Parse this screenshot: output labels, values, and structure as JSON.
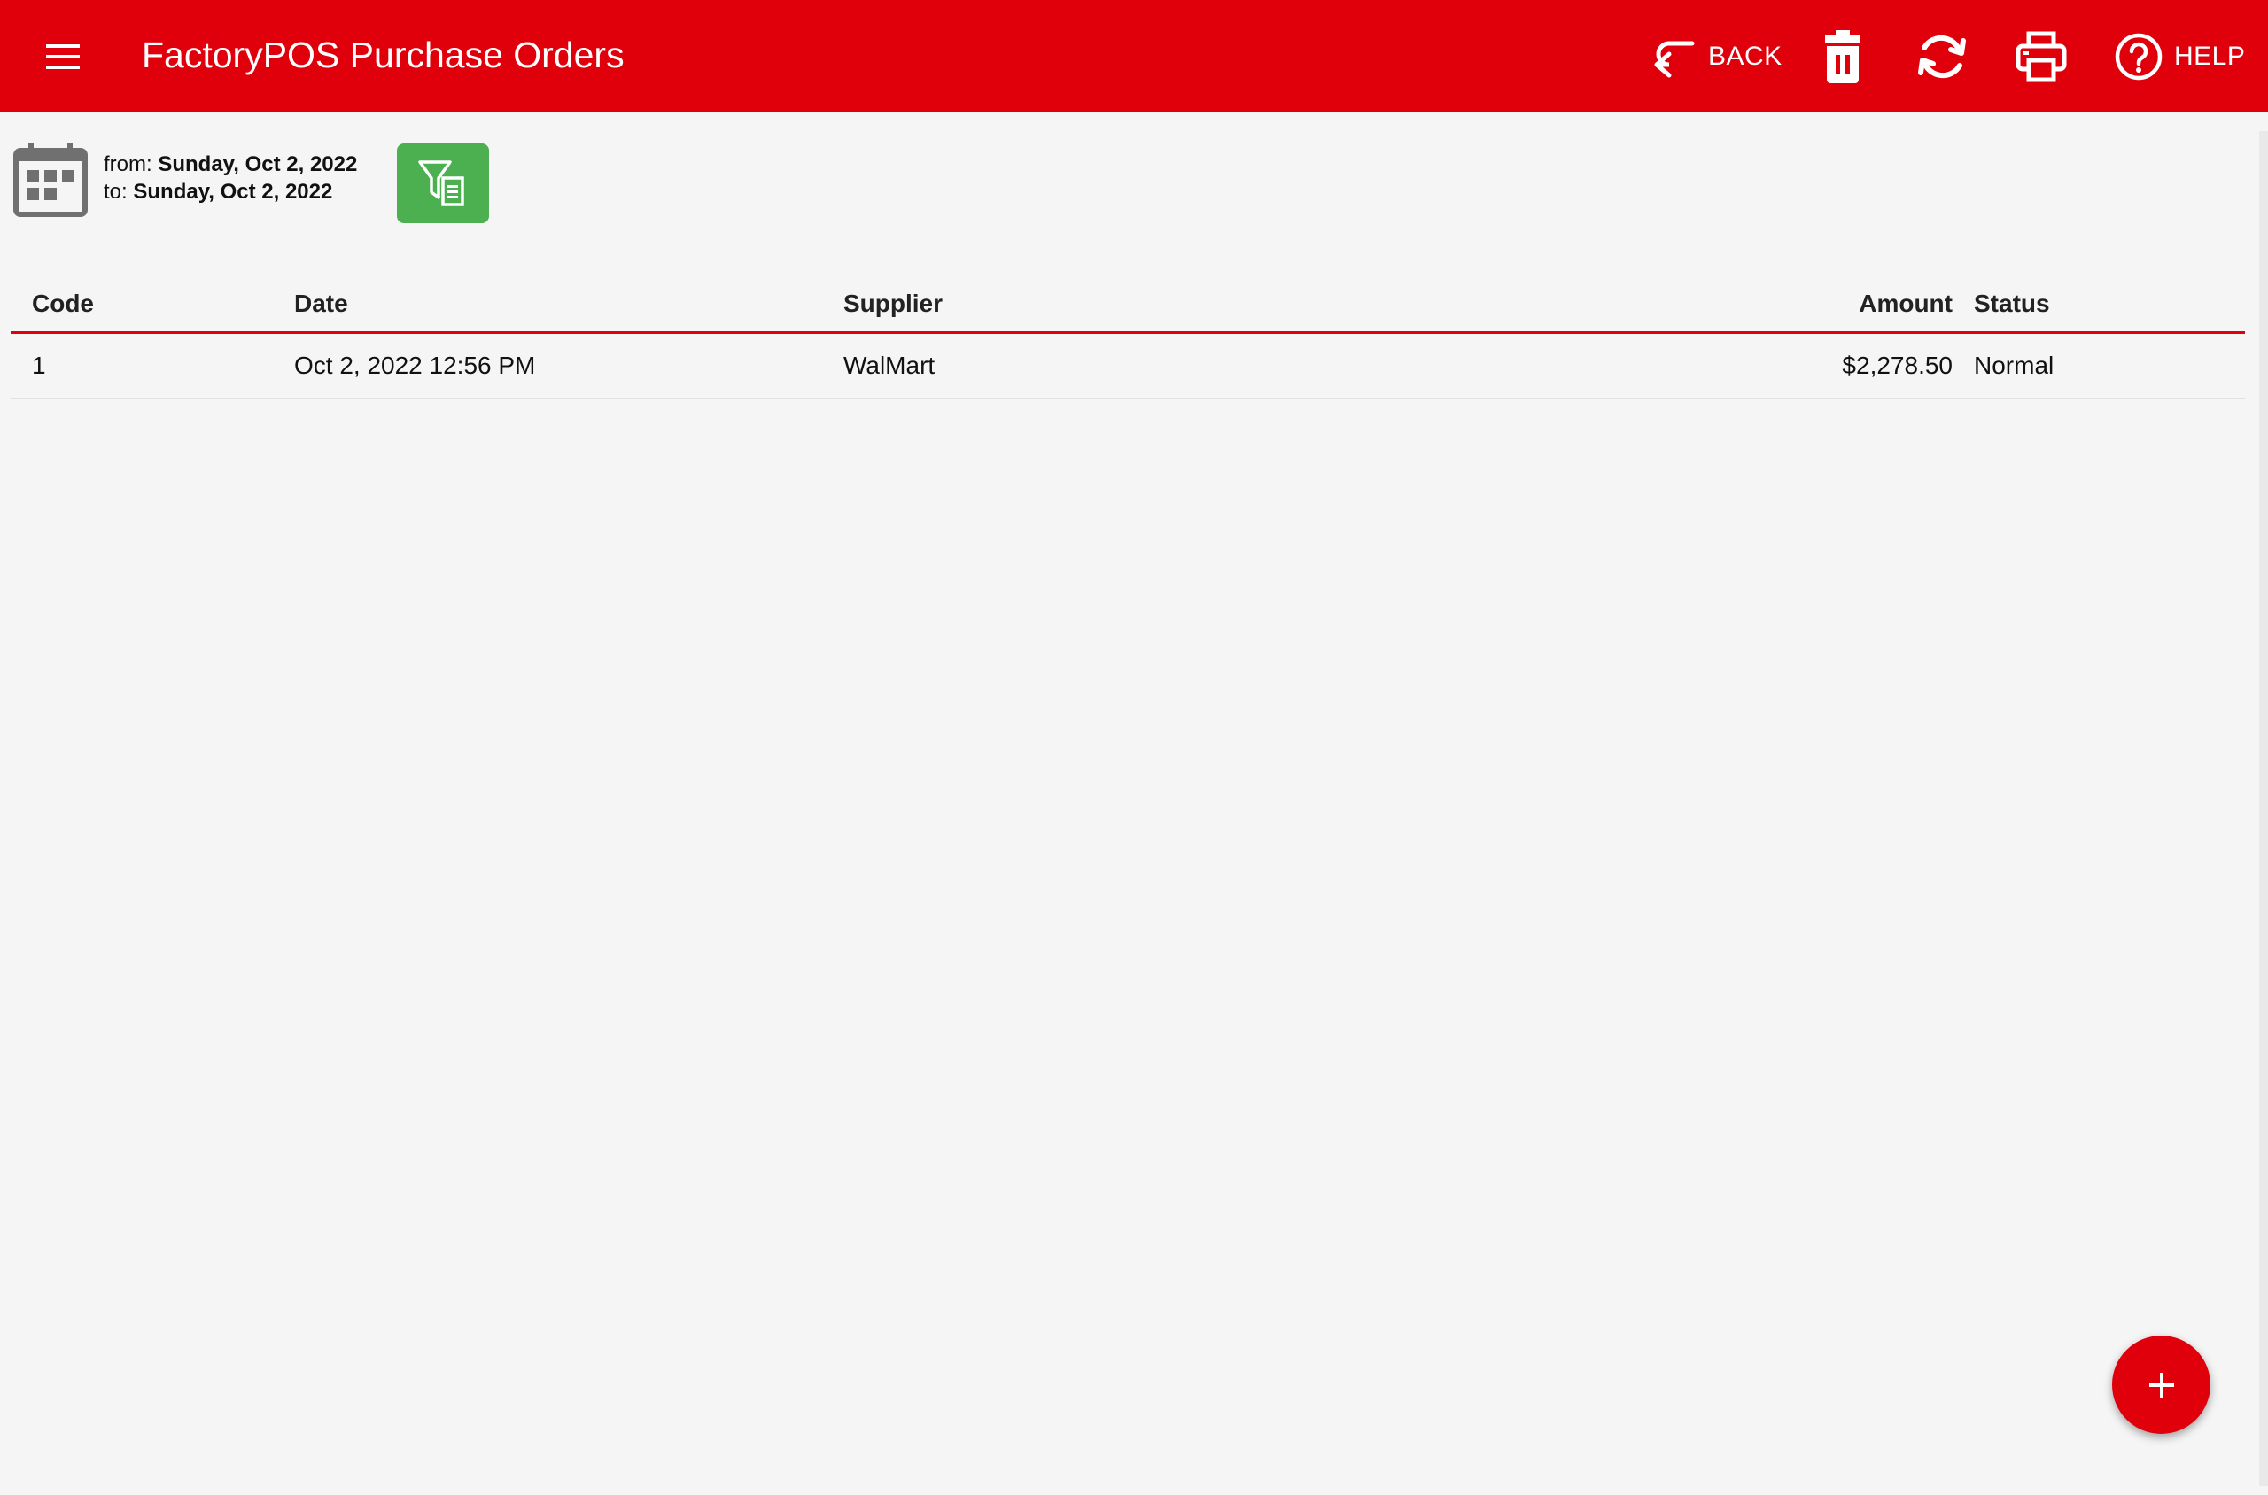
{
  "header": {
    "title": "FactoryPOS Purchase Orders",
    "back_label": "BACK",
    "help_label": "HELP",
    "color": "#e0000b"
  },
  "filter": {
    "from_label": "from:",
    "from_value": "Sunday, Oct 2, 2022",
    "to_label": "to:",
    "to_value": "Sunday, Oct 2, 2022",
    "button_color": "#4caf50"
  },
  "table": {
    "columns": [
      "Code",
      "Date",
      "Supplier",
      "Amount",
      "Status"
    ],
    "rows": [
      {
        "code": "1",
        "date": "Oct 2, 2022 12:56 PM",
        "supplier": "WalMart",
        "amount": "$2,278.50",
        "status": "Normal"
      }
    ]
  },
  "icons": {
    "menu": "menu-icon",
    "back": "back-arrow-icon",
    "delete": "trash-icon",
    "refresh": "refresh-icon",
    "print": "printer-icon",
    "help": "help-circle-icon",
    "calendar": "calendar-icon",
    "filter": "filter-report-icon",
    "add": "plus-icon"
  }
}
